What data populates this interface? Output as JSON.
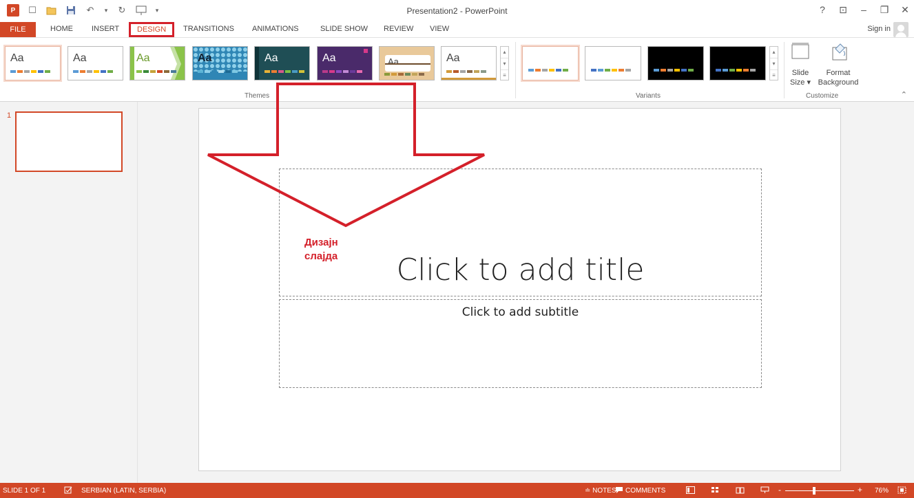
{
  "window": {
    "title": "Presentation2 - PowerPoint",
    "help": "?",
    "restore_ribbon": "⊡",
    "minimize": "–",
    "restore": "❐",
    "close": "✕"
  },
  "qat": {
    "logo": "P",
    "new": "☐",
    "open": "📂",
    "save": "💾",
    "undo": "↶",
    "undo_drop": "▾",
    "redo": "↻",
    "present": "▭",
    "customize": "▾"
  },
  "tabs": {
    "file": "FILE",
    "home": "HOME",
    "insert": "INSERT",
    "design": "DESIGN",
    "transitions": "TRANSITIONS",
    "animations": "ANIMATIONS",
    "slideshow": "SLIDE SHOW",
    "review": "REVIEW",
    "view": "VIEW"
  },
  "account": {
    "signin": "Sign in"
  },
  "ribbon": {
    "themes_label": "Themes",
    "variants_label": "Variants",
    "customize_label": "Customize",
    "theme_tile_text": "Aa",
    "slide_size_line1": "Slide",
    "slide_size_line2": "Size ▾",
    "format_bg_line1": "Format",
    "format_bg_line2": "Background",
    "collapse": "⌃",
    "scroll_up": "▴",
    "scroll_down": "▾",
    "scroll_more": "≡",
    "colors": {
      "bar1": "#5b9bd5",
      "bar2": "#ed7d31",
      "bar3": "#a5a5a5",
      "bar4": "#ffc000",
      "bar5": "#4472c4",
      "bar6": "#70ad47"
    }
  },
  "thumbnails": {
    "number": "1"
  },
  "slide": {
    "title_placeholder": "Click to add title",
    "subtitle_placeholder": "Click to add subtitle"
  },
  "annotation": {
    "line1": "Дизајн",
    "line2": "слајда",
    "color": "#d4202a"
  },
  "status": {
    "slide_count": "SLIDE 1 OF 1",
    "language": "SERBIAN (LATIN, SERBIA)",
    "notes": "≐ NOTES",
    "comments": "COMMENTS",
    "zoom_minus": "-",
    "zoom_plus": "+",
    "zoom": "76%"
  },
  "accent_color": "#d24726"
}
